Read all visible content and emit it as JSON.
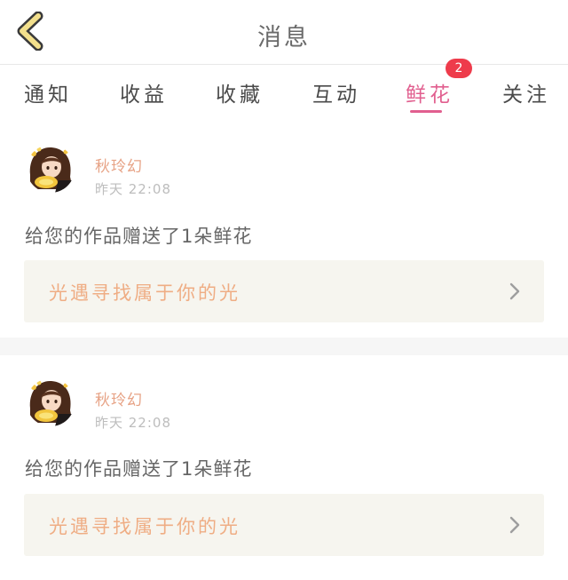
{
  "header": {
    "title": "消息"
  },
  "tabs": [
    {
      "label": "通知"
    },
    {
      "label": "收益"
    },
    {
      "label": "收藏"
    },
    {
      "label": "互动"
    },
    {
      "label": "鲜花",
      "badge": "2",
      "active": true
    },
    {
      "label": "关注"
    }
  ],
  "messages": [
    {
      "username": "秋玲幻",
      "time": "昨天 22:08",
      "text": "给您的作品赠送了1朵鲜花",
      "work_title": "光遇寻找属于你的光"
    },
    {
      "username": "秋玲幻",
      "time": "昨天 22:08",
      "text": "给您的作品赠送了1朵鲜花",
      "work_title": "光遇寻找属于你的光"
    }
  ],
  "colors": {
    "accent": "#e15f8f",
    "badge": "#ee3b4b",
    "username": "#e7a386",
    "work_title": "#efad84",
    "back_icon": "#f3e08c"
  },
  "icons": {
    "back": "chevron-left-icon",
    "item_arrow": "chevron-right-icon"
  }
}
